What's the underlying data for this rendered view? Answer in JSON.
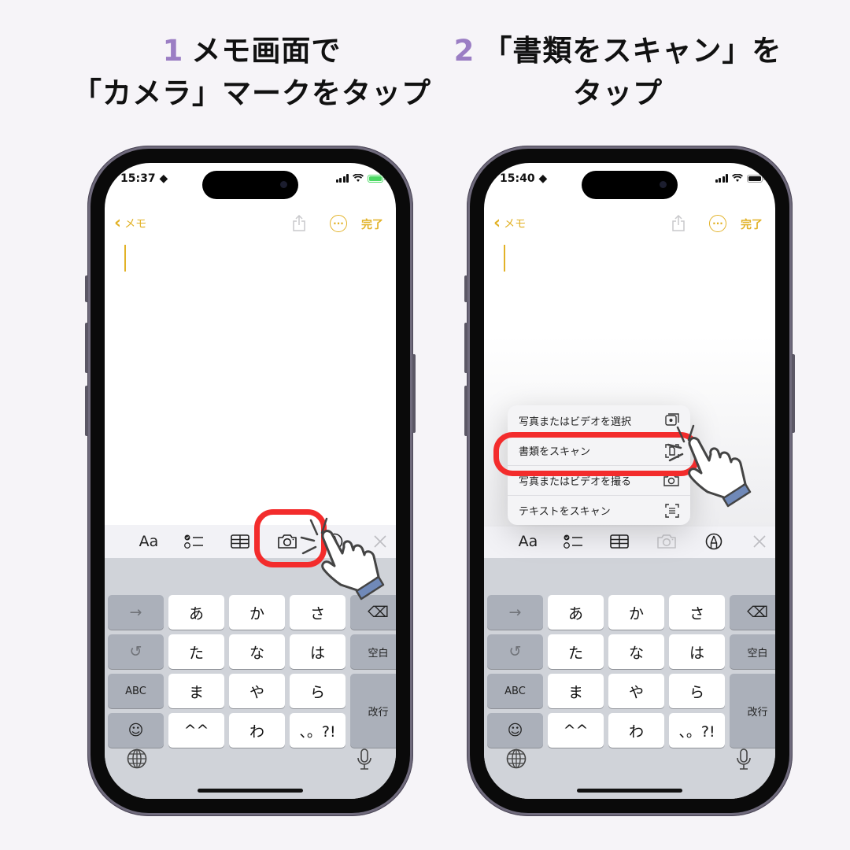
{
  "steps": [
    {
      "number": "1",
      "title_line1": "メモ画面で",
      "title_line2": "「カメラ」マークをタップ",
      "status": {
        "time": "15:37",
        "battery_state": "charging",
        "battery_color": "#4cd964"
      },
      "nav": {
        "back_label": "メモ",
        "done_label": "完了"
      },
      "toolbar": {
        "format_label": "Aa",
        "camera_state": "highlighted"
      }
    },
    {
      "number": "2",
      "title_line1": "「書類をスキャン」を",
      "title_line2": "タップ",
      "status": {
        "time": "15:40",
        "battery_state": "full",
        "battery_color": "#111111"
      },
      "nav": {
        "back_label": "メモ",
        "done_label": "完了"
      },
      "toolbar": {
        "format_label": "Aa",
        "camera_state": "disabled"
      },
      "menu": {
        "items": [
          {
            "label": "写真またはビデオを選択",
            "icon": "photo-library-icon"
          },
          {
            "label": "書類をスキャン",
            "icon": "document-scan-icon",
            "highlighted": true
          },
          {
            "label": "写真またはビデオを撮る",
            "icon": "camera-icon"
          },
          {
            "label": "テキストをスキャン",
            "icon": "text-scan-icon"
          }
        ]
      }
    }
  ],
  "keyboard": {
    "rows": [
      [
        "→",
        "あ",
        "か",
        "さ",
        "⌫"
      ],
      [
        "↺",
        "た",
        "な",
        "は",
        "空白"
      ],
      [
        "ABC",
        "ま",
        "や",
        "ら",
        "改行"
      ],
      [
        "☺",
        "^^",
        "わ",
        "、。?!"
      ]
    ]
  },
  "colors": {
    "accent": "#e2b227",
    "step_number": "#9b7ec4",
    "highlight": "#f32c2c",
    "hand_cuff": "#7089b8"
  }
}
